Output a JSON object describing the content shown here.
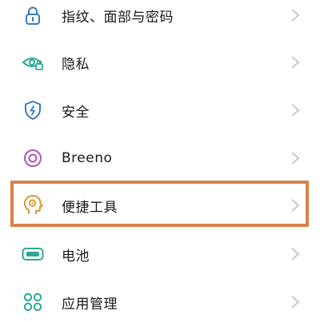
{
  "settings_list": {
    "items": [
      {
        "label": "指纹、面部与密码",
        "icon": "lock-icon"
      },
      {
        "label": "隐私",
        "icon": "eye-lock-icon"
      },
      {
        "label": "安全",
        "icon": "shield-icon"
      },
      {
        "label": "Breeno",
        "icon": "breeno-icon"
      },
      {
        "label": "便捷工具",
        "icon": "head-gear-icon"
      },
      {
        "label": "电池",
        "icon": "battery-icon"
      },
      {
        "label": "应用管理",
        "icon": "app-grid-icon"
      }
    ]
  },
  "colors": {
    "icon_blue": "#3a78c4",
    "icon_green": "#2ba894",
    "icon_purple": "#b064b8",
    "icon_orange": "#e0962a",
    "highlight_border": "#d9804a",
    "chevron": "#c8c8c8",
    "text": "#1a1a1a"
  }
}
